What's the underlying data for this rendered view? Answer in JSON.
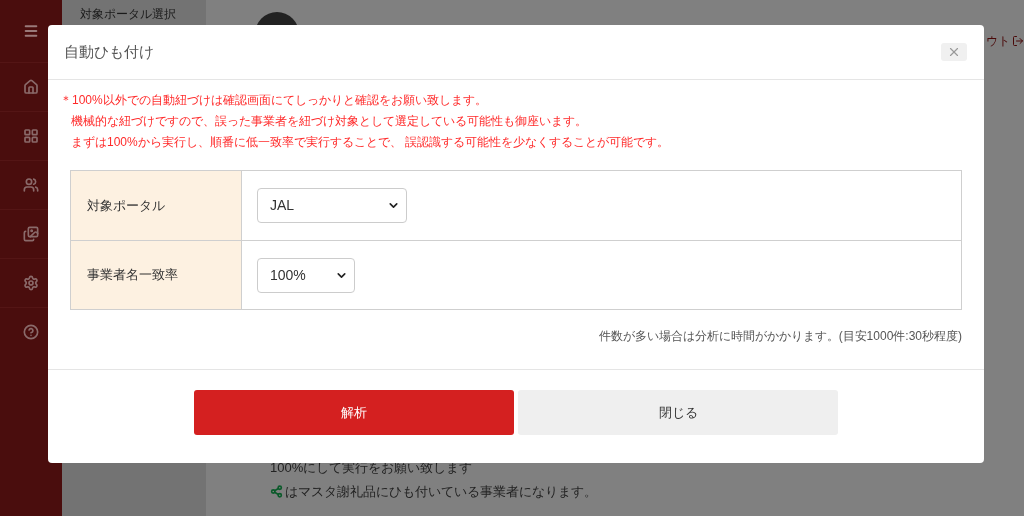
{
  "background": {
    "panel_title": "対象ポータル選択",
    "header_link": "ウト",
    "footer_lines": [
      {
        "kind": "plain",
        "text": "100%にして実行をお願い致します"
      },
      {
        "kind": "share",
        "text": "はマスタ謝礼品にひも付いている事業者になります。"
      }
    ]
  },
  "modal": {
    "title": "自動ひも付け",
    "notes": [
      "＊100%以外での自動紐づけは確認画面にてしっかりと確認をお願い致します。",
      "機械的な紐づけですので、誤った事業者を紐づけ対象として選定している可能性も御座います。",
      "まずは100%から実行し、順番に低一致率で実行することで、 誤認識する可能性を少なくすることが可能です。"
    ],
    "form": [
      {
        "label": "対象ポータル",
        "value": "JAL"
      },
      {
        "label": "事業者名一致率",
        "value": "100%"
      }
    ],
    "hint": "件数が多い場合は分析に時間がかかります。(目安1000件:30秒程度)",
    "buttons": [
      {
        "label": "解析",
        "kind": "primary"
      },
      {
        "label": "閉じる",
        "kind": "secondary"
      }
    ]
  }
}
